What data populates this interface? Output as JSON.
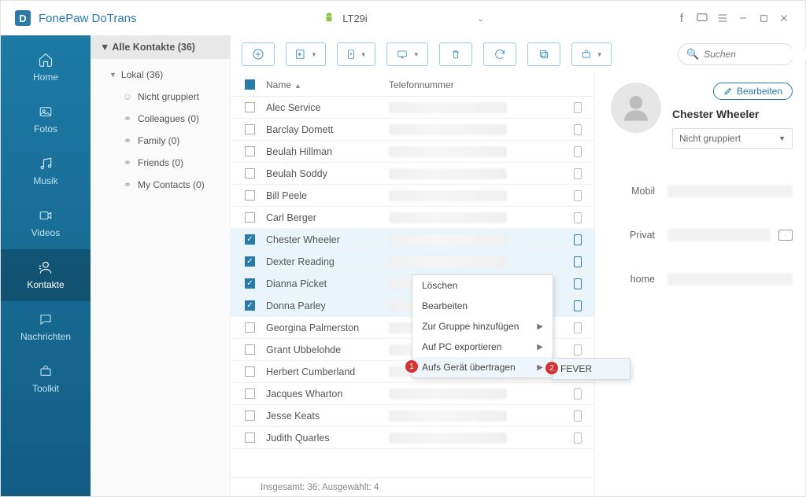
{
  "app": {
    "name": "FonePaw DoTrans",
    "device": "LT29i"
  },
  "nav": {
    "items": [
      {
        "id": "home",
        "label": "Home"
      },
      {
        "id": "photos",
        "label": "Fotos"
      },
      {
        "id": "music",
        "label": "Musik"
      },
      {
        "id": "videos",
        "label": "Videos"
      },
      {
        "id": "contacts",
        "label": "Kontakte"
      },
      {
        "id": "messages",
        "label": "Nachrichten"
      },
      {
        "id": "toolkit",
        "label": "Toolkit"
      }
    ],
    "active": "contacts"
  },
  "groups": {
    "header": "Alle Kontakte  (36)",
    "local": "Lokal  (36)",
    "items": [
      {
        "label": "Nicht gruppiert"
      },
      {
        "label": "Colleagues  (0)"
      },
      {
        "label": "Family  (0)"
      },
      {
        "label": "Friends  (0)"
      },
      {
        "label": "My Contacts  (0)"
      }
    ]
  },
  "table": {
    "col_name": "Name",
    "col_tel": "Telefonnummer",
    "rows": [
      {
        "name": "Alec Service",
        "checked": false
      },
      {
        "name": "Barclay Domett",
        "checked": false
      },
      {
        "name": "Beulah Hillman",
        "checked": false
      },
      {
        "name": "Beulah Soddy",
        "checked": false
      },
      {
        "name": "Bill Peele",
        "checked": false
      },
      {
        "name": "Carl Berger",
        "checked": false
      },
      {
        "name": "Chester Wheeler",
        "checked": true
      },
      {
        "name": "Dexter Reading",
        "checked": true
      },
      {
        "name": "Dianna Picket",
        "checked": true
      },
      {
        "name": "Donna Parley",
        "checked": true
      },
      {
        "name": "Georgina Palmerston",
        "checked": false
      },
      {
        "name": "Grant Ubbelohde",
        "checked": false
      },
      {
        "name": "Herbert Cumberland",
        "checked": false
      },
      {
        "name": "Jacques Wharton",
        "checked": false
      },
      {
        "name": "Jesse Keats",
        "checked": false
      },
      {
        "name": "Judith Quarles",
        "checked": false
      }
    ],
    "status": "Insgesamt: 36; Ausgewählt: 4"
  },
  "context_menu": {
    "items": [
      {
        "label": "Löschen"
      },
      {
        "label": "Bearbeiten"
      },
      {
        "label": "Zur Gruppe hinzufügen",
        "submenu": true
      },
      {
        "label": "Auf PC exportieren",
        "submenu": true
      },
      {
        "label": "Aufs Gerät übertragen",
        "submenu": true,
        "highlight": true,
        "badge": "1"
      }
    ],
    "submenu": {
      "label": "FEVER",
      "badge": "2"
    }
  },
  "detail": {
    "edit": "Bearbeiten",
    "name": "Chester Wheeler",
    "group": "Nicht gruppiert",
    "fields": [
      {
        "label": "Mobil"
      },
      {
        "label": "Privat",
        "mail": true
      },
      {
        "label": "home"
      }
    ]
  },
  "search": {
    "placeholder": "Suchen"
  }
}
